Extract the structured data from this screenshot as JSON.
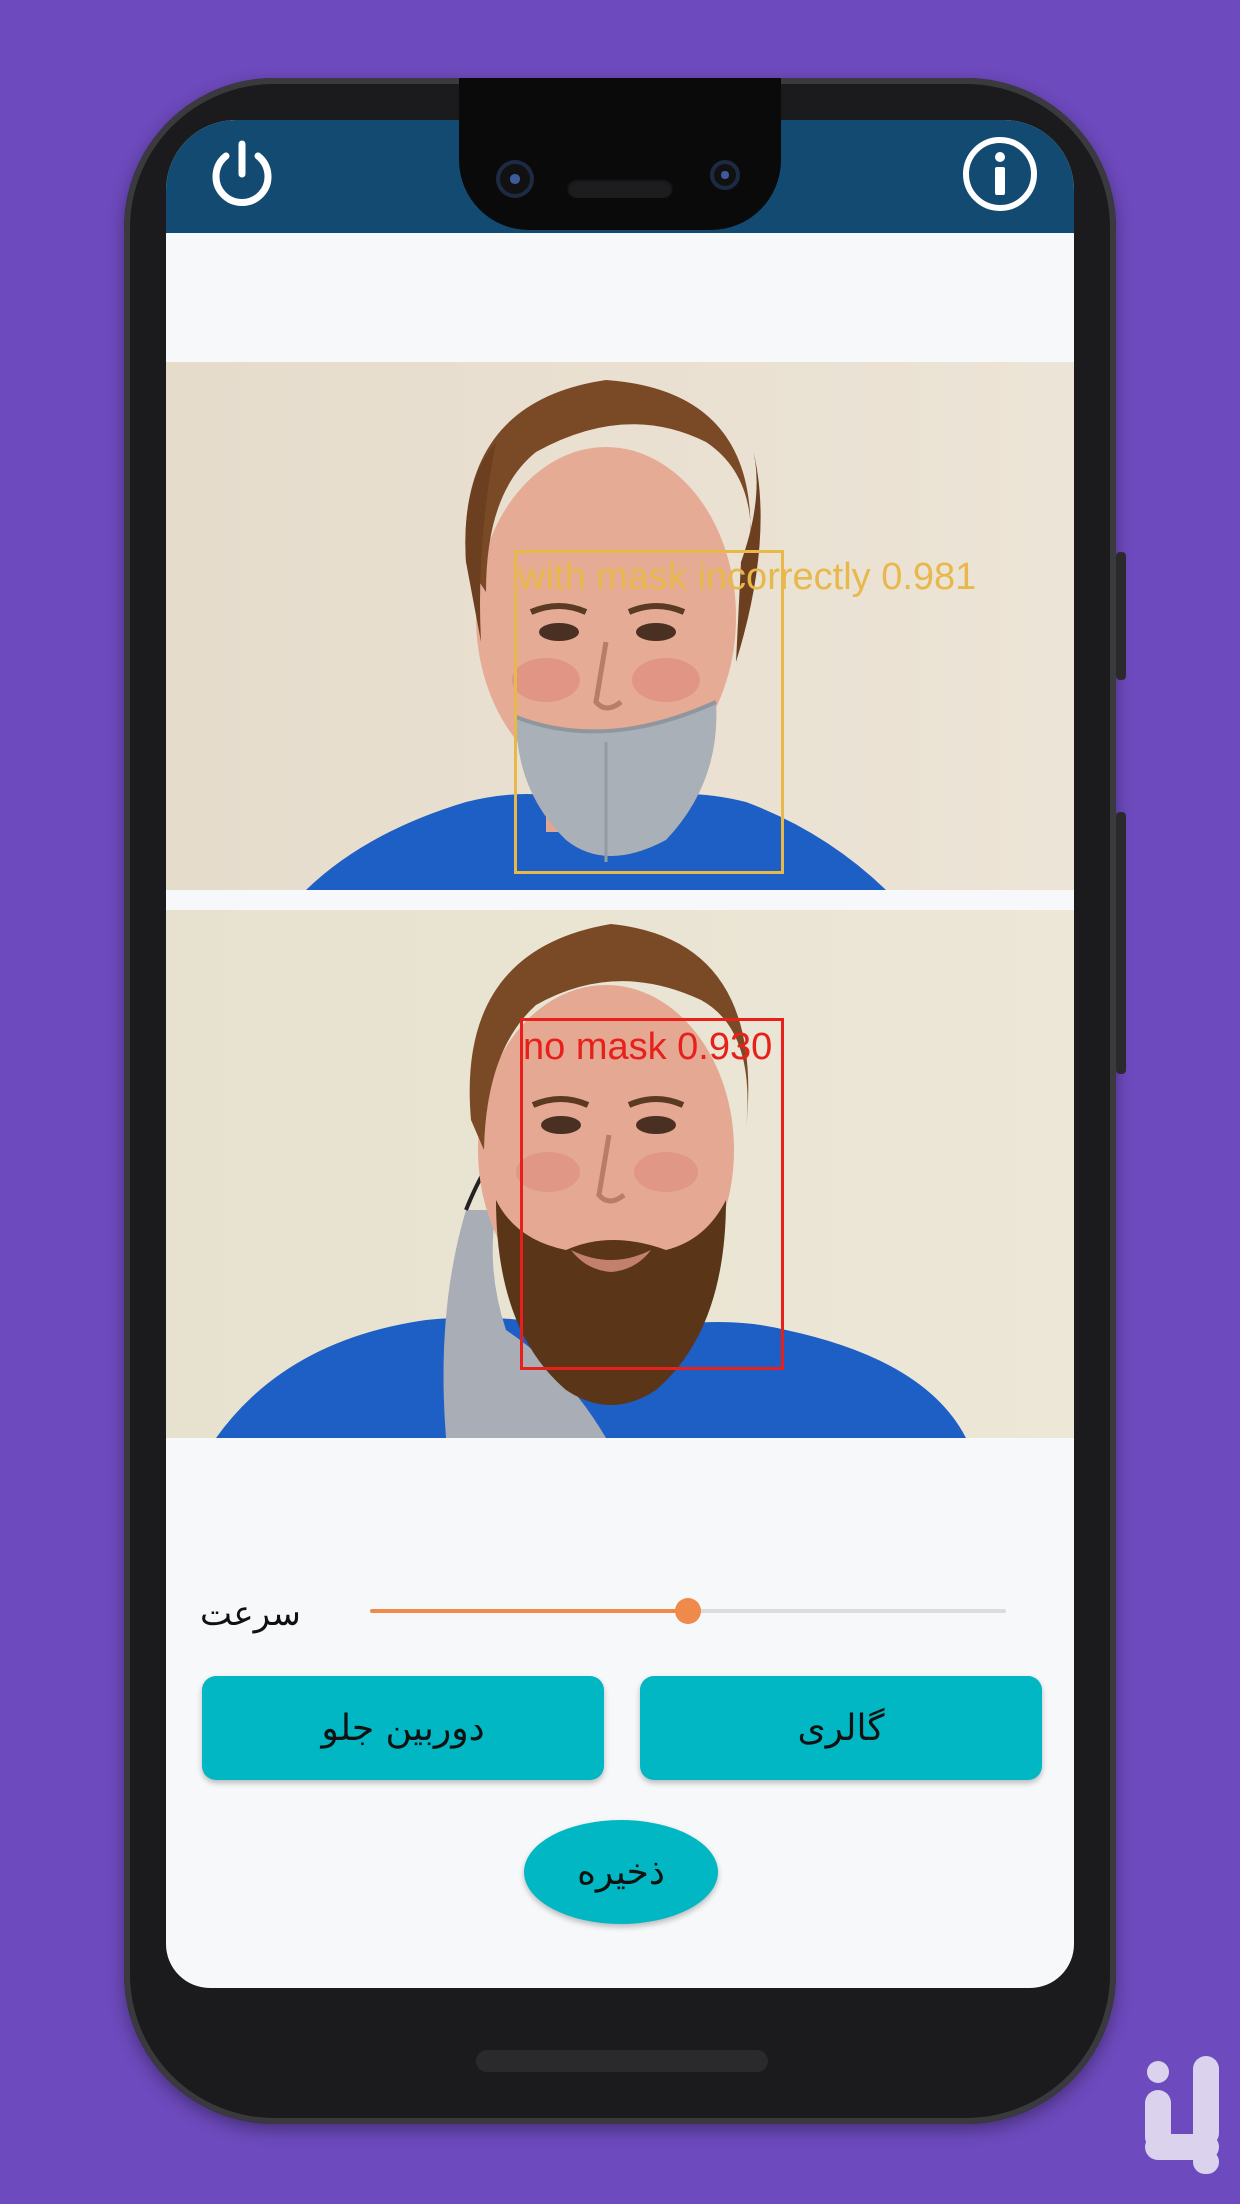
{
  "colors": {
    "background": "#6d4abd",
    "app_bar": "#124a72",
    "button": "#00b7c3",
    "slider_accent": "#f08a4b",
    "mask_incorrect_box": "#e8b84a",
    "no_mask_box": "#e8201c"
  },
  "app_bar": {
    "left_icon": "power-icon",
    "right_icon": "info-icon"
  },
  "detections": [
    {
      "label": "with mask incorrectly 0.981",
      "color": "#e8b84a"
    },
    {
      "label": "no mask 0.930",
      "color": "#e8201c"
    }
  ],
  "speed_control": {
    "label": "سرعت",
    "value": 0.5
  },
  "buttons": {
    "gallery": "گالری",
    "front_camera": "دوربین جلو",
    "save": "ذخیره"
  },
  "watermark_icon": "bazaar-logo-icon"
}
